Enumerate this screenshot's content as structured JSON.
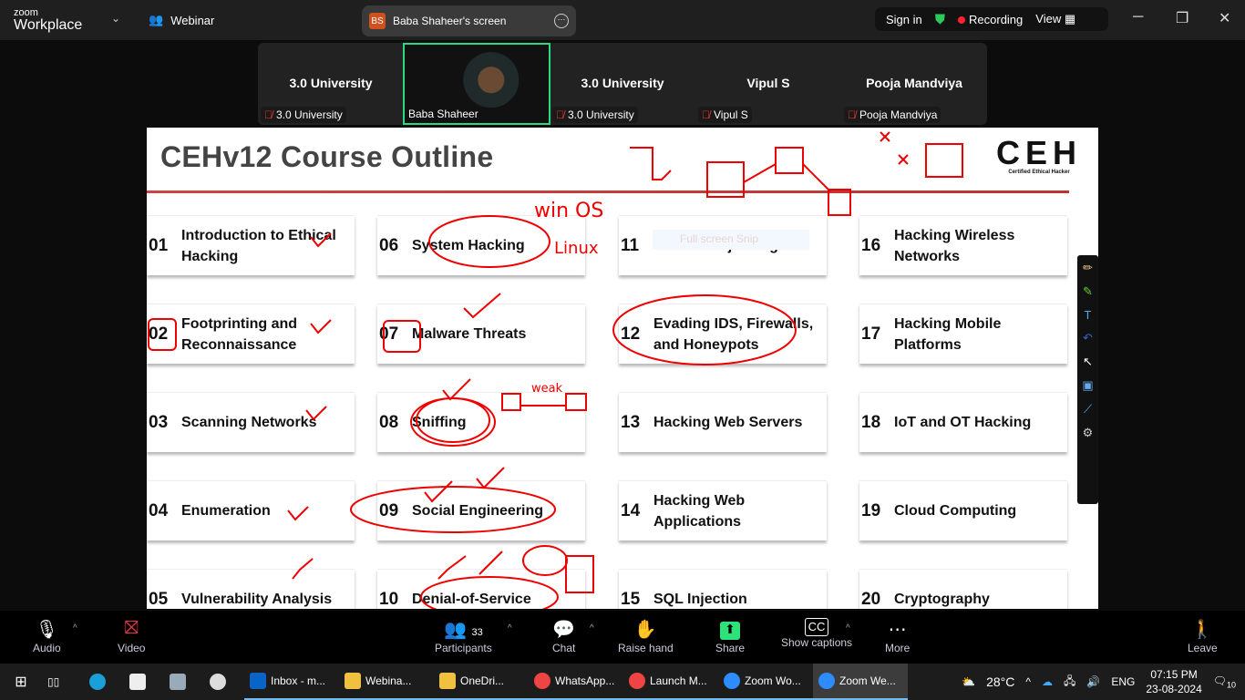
{
  "topbar": {
    "brand_small": "zoom",
    "brand_big": "Workplace",
    "webinar": "Webinar",
    "screen_initials": "BS",
    "screen_label": "Baba Shaheer's screen",
    "sign_in": "Sign in",
    "recording": "Recording",
    "view": "View"
  },
  "participants": [
    {
      "name": "3.0 University",
      "label": "3.0 University"
    },
    {
      "name": "",
      "label": "Baba Shaheer",
      "video": true
    },
    {
      "name": "3.0 University",
      "label": "3.0 University"
    },
    {
      "name": "Vipul S",
      "label": "Vipul S"
    },
    {
      "name": "Pooja Mandviya",
      "label": "Pooja Mandviya"
    }
  ],
  "slide": {
    "title": "CEHv12 Course Outline",
    "logo": "CEH",
    "logo_sub": "Certified  Ethical  Hacker",
    "snip_overlay": "Full screen Snip",
    "modules": [
      {
        "num": "01",
        "title": "Introduction to Ethical Hacking"
      },
      {
        "num": "02",
        "title": "Footprinting and Reconnaissance"
      },
      {
        "num": "03",
        "title": "Scanning Networks"
      },
      {
        "num": "04",
        "title": "Enumeration"
      },
      {
        "num": "05",
        "title": "Vulnerability Analysis"
      },
      {
        "num": "06",
        "title": "System Hacking"
      },
      {
        "num": "07",
        "title": "Malware Threats"
      },
      {
        "num": "08",
        "title": "Sniffing"
      },
      {
        "num": "09",
        "title": "Social Engineering"
      },
      {
        "num": "10",
        "title": "Denial-of-Service"
      },
      {
        "num": "11",
        "title": "Session Hijacking"
      },
      {
        "num": "12",
        "title": "Evading IDS, Firewalls, and Honeypots"
      },
      {
        "num": "13",
        "title": "Hacking Web Servers"
      },
      {
        "num": "14",
        "title": "Hacking Web Applications"
      },
      {
        "num": "15",
        "title": "SQL Injection"
      },
      {
        "num": "16",
        "title": "Hacking Wireless Networks"
      },
      {
        "num": "17",
        "title": "Hacking Mobile Platforms"
      },
      {
        "num": "18",
        "title": "IoT and OT Hacking"
      },
      {
        "num": "19",
        "title": "Cloud Computing"
      },
      {
        "num": "20",
        "title": "Cryptography"
      }
    ],
    "annotations": {
      "win": "win OS",
      "linux": "Linux",
      "weak": "weak",
      "accent": "#e00000"
    }
  },
  "toolbar": {
    "audio": "Audio",
    "video": "Video",
    "participants": "Participants",
    "participants_count": "33",
    "chat": "Chat",
    "raise_hand": "Raise hand",
    "share": "Share",
    "captions": "Show captions",
    "more": "More",
    "leave": "Leave",
    "share_color": "#2ee27a"
  },
  "taskbar": {
    "apps": [
      "Inbox - m...",
      "Webina...",
      "OneDri...",
      "WhatsApp...",
      "Launch M...",
      "Zoom Wo...",
      "Zoom We..."
    ],
    "weather": "28°C",
    "lang": "ENG",
    "time": "07:15 PM",
    "date": "23-08-2024",
    "notifications": "10"
  }
}
